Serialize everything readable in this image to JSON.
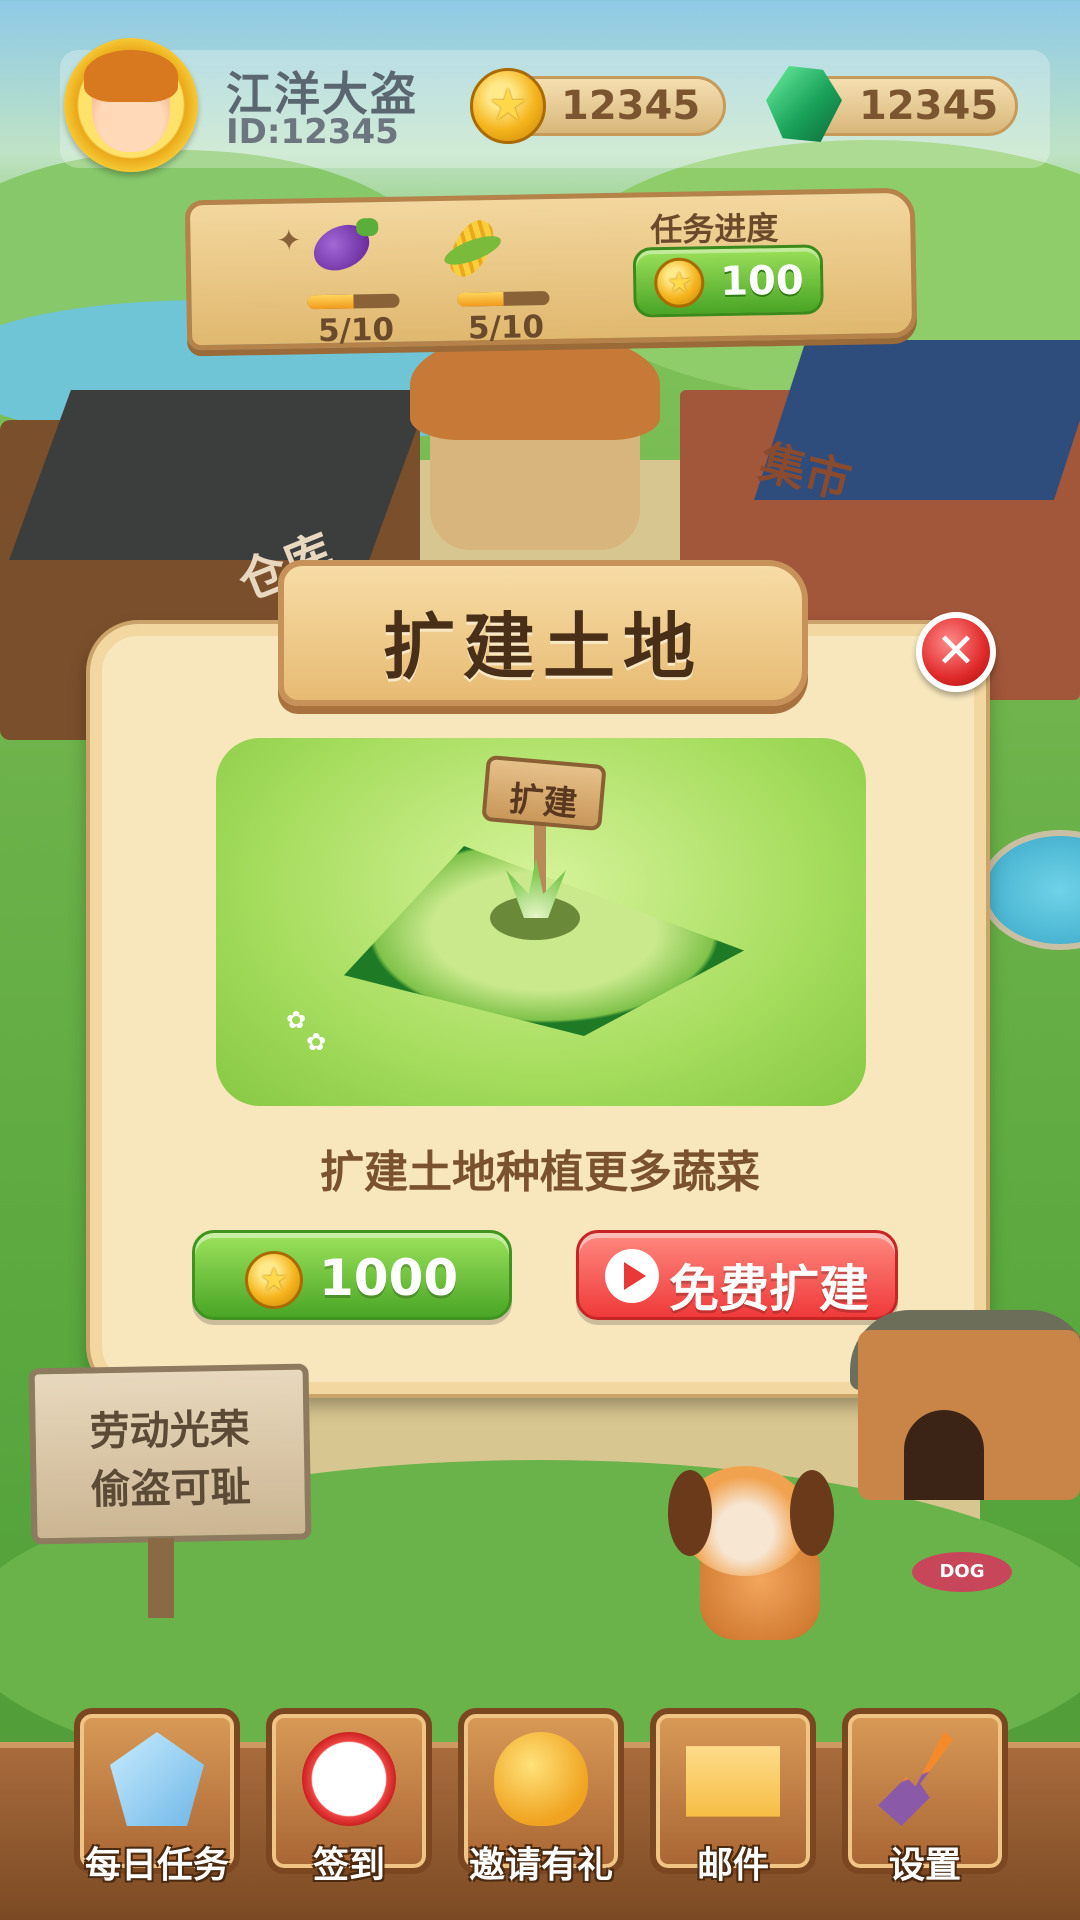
{
  "player": {
    "name": "江洋大盗",
    "id": "ID:12345",
    "avatar_icon": "boy-avatar-icon"
  },
  "currencies": {
    "coins": "12345",
    "gems": "12345"
  },
  "task_board": {
    "items": [
      {
        "icon": "eggplant-icon",
        "progress_text": "5/10",
        "progress": 0.5
      },
      {
        "icon": "corn-icon",
        "progress_text": "5/10",
        "progress": 0.5
      }
    ],
    "title": "任务进度",
    "reward": "100"
  },
  "map_labels": {
    "warehouse": "仓库",
    "market": "集市"
  },
  "dialog": {
    "title": "扩建土地",
    "sign_text": "扩建",
    "description": "扩建土地种植更多蔬菜",
    "coin_button_label": "1000",
    "free_button_label": "免费扩建",
    "close_icon": "close-icon"
  },
  "slogan": {
    "line1": "劳动光荣",
    "line2": "偷盗可耻"
  },
  "dog_bowl_label": "DOG",
  "bottom_menu": [
    {
      "label": "每日任务",
      "icon": "crystal-clock-icon"
    },
    {
      "label": "签到",
      "icon": "alarm-clock-icon"
    },
    {
      "label": "邀请有礼",
      "icon": "gift-egg-icon"
    },
    {
      "label": "邮件",
      "icon": "envelope-icon"
    },
    {
      "label": "设置",
      "icon": "shovel-icon"
    }
  ],
  "colors": {
    "accent_green": "#4aa526",
    "accent_red": "#ef3a3a",
    "wood": "#c6925a",
    "parchment": "#f8e7bd"
  }
}
